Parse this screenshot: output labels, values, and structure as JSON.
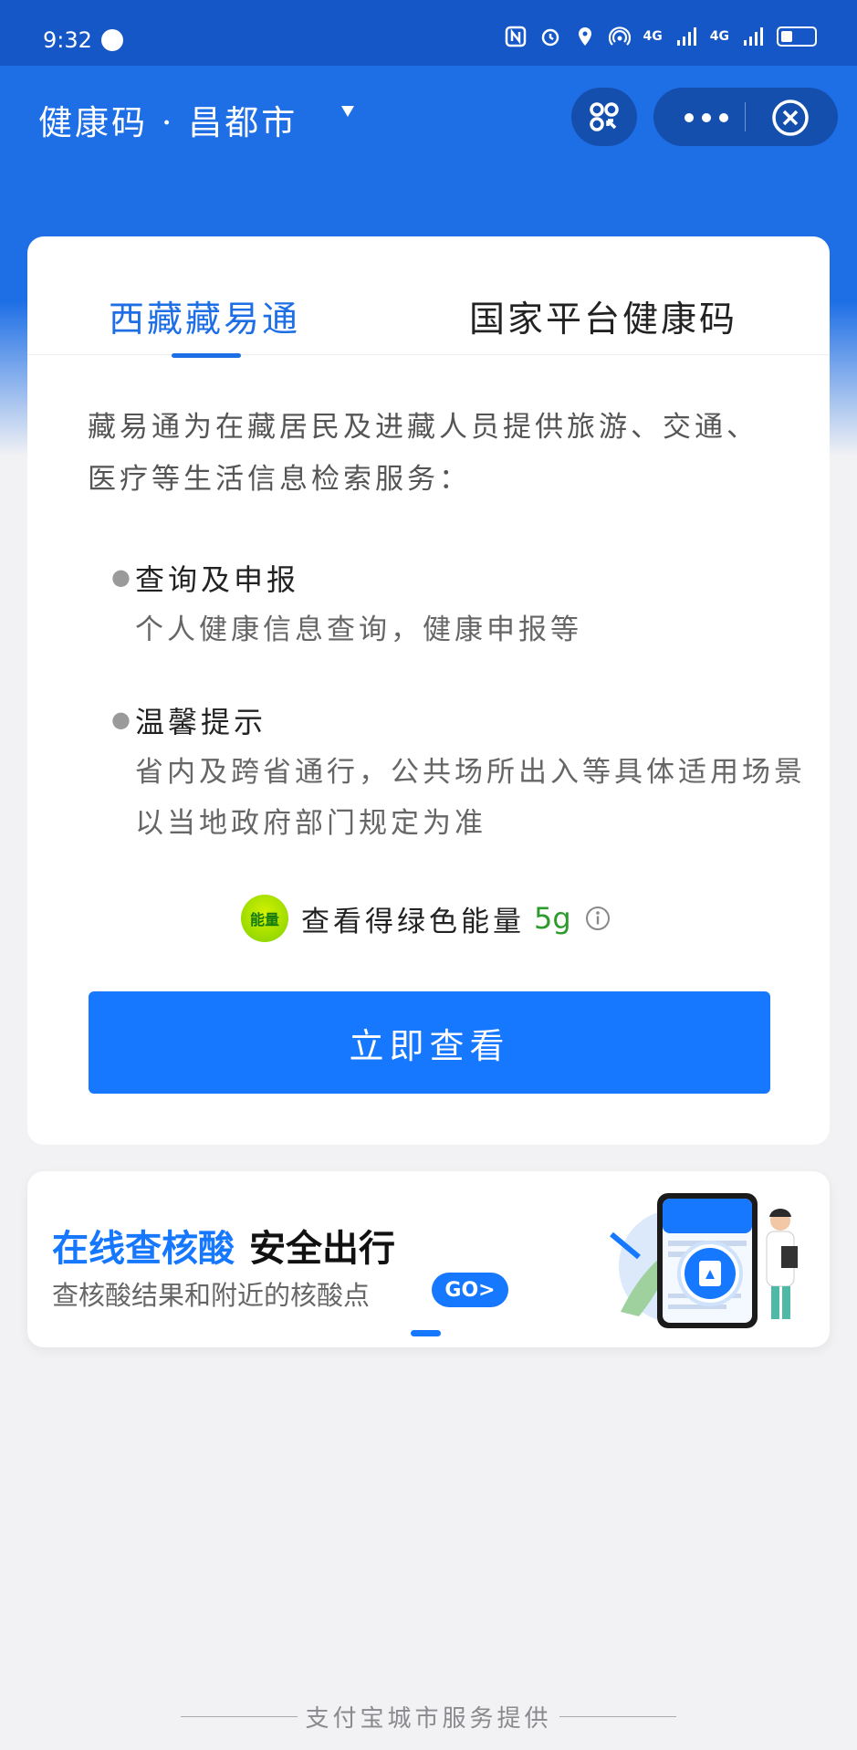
{
  "status_bar": {
    "time": "9:32",
    "network_1": "4G",
    "network_2": "4G"
  },
  "nav": {
    "title": "健康码 · 昌都市"
  },
  "card": {
    "tabs": [
      {
        "label": "西藏藏易通",
        "active": true
      },
      {
        "label": "国家平台健康码",
        "active": false
      }
    ],
    "intro": "藏易通为在藏居民及进藏人员提供旅游、交通、医疗等生活信息检索服务：",
    "sections": [
      {
        "title": "查询及申报",
        "desc": "个人健康信息查询，健康申报等"
      },
      {
        "title": "温馨提示",
        "desc": "省内及跨省通行，公共场所出入等具体适用场景以当地政府部门规定为准"
      }
    ],
    "energy": {
      "badge": "能量",
      "text": "查看得绿色能量",
      "amount": "5g"
    },
    "button_label": "立即查看"
  },
  "banner": {
    "title_blue": "在线查核酸",
    "title_dark": "安全出行",
    "subtitle": "查核酸结果和附近的核酸点",
    "go_label": "GO>"
  },
  "footer": {
    "text": "支付宝城市服务提供"
  },
  "colors": {
    "brand_blue": "#1677ff",
    "header_blue": "#1e6fe6",
    "energy_green": "#2c9a2c"
  }
}
